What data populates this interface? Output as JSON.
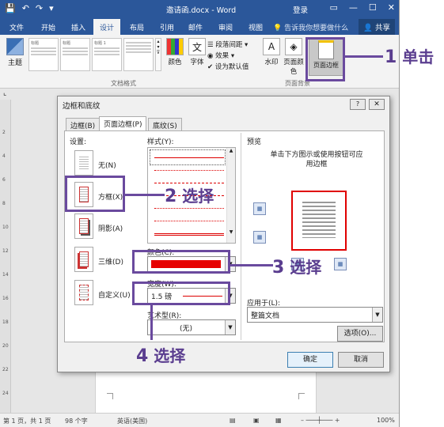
{
  "window": {
    "title": "邀请函.docx - Word",
    "login": "登录",
    "controls": [
      "▭",
      "—",
      "☐",
      "✕"
    ]
  },
  "tabs": [
    "文件",
    "开始",
    "插入",
    "设计",
    "布局",
    "引用",
    "邮件",
    "审阅",
    "视图"
  ],
  "active_tab": "设计",
  "tell_me": "告诉我你想要做什么",
  "share": "共享",
  "ribbon": {
    "theme_label": "主题",
    "style_thumbs": [
      "标题",
      "标题",
      "标题 1"
    ],
    "doc_format_label": "文档格式",
    "colors_label": "颜色",
    "fonts_label": "字体",
    "para_spacing": "段落间距",
    "effects": "效果",
    "set_default": "设为默认值",
    "watermark": "水印",
    "page_color": "页面颜色",
    "page_borders": "页面边框",
    "page_bg_label": "页面背景"
  },
  "ruler_ticks": [
    "2",
    "4",
    "6",
    "8",
    "10",
    "12",
    "14",
    "16",
    "18",
    "20",
    "22",
    "24"
  ],
  "dialog": {
    "title": "边框和底纹",
    "help": "?",
    "close": "✕",
    "tabs": [
      "边框(B)",
      "页面边框(P)",
      "底纹(S)"
    ],
    "active_tab": "页面边框(P)",
    "settings_label": "设置:",
    "settings": [
      "无(N)",
      "方框(X)",
      "阴影(A)",
      "三维(D)",
      "自定义(U)"
    ],
    "style_label": "样式(Y):",
    "color_label": "颜色(C):",
    "color_value": "#e60000",
    "width_label": "宽度(W):",
    "width_value": "1.5 磅",
    "art_label": "艺术型(R):",
    "art_value": "(无)",
    "preview_label": "预览",
    "preview_hint": "单击下方图示或使用按钮可应用边框",
    "apply_to_label": "应用于(L):",
    "apply_to_value": "整篇文档",
    "options_button": "选项(O)...",
    "ok_button": "确定",
    "cancel_button": "取消"
  },
  "annotations": {
    "step1": {
      "num": "1",
      "text": "单击"
    },
    "step2": {
      "num": "2",
      "text": "选择"
    },
    "step3": {
      "num": "3",
      "text": "选择"
    },
    "step4": {
      "num": "4",
      "text": "选择"
    }
  },
  "statusbar": {
    "page": "第 1 页，共 1 页",
    "words": "98 个字",
    "lang": "英语(美国)",
    "zoom": "100%"
  }
}
